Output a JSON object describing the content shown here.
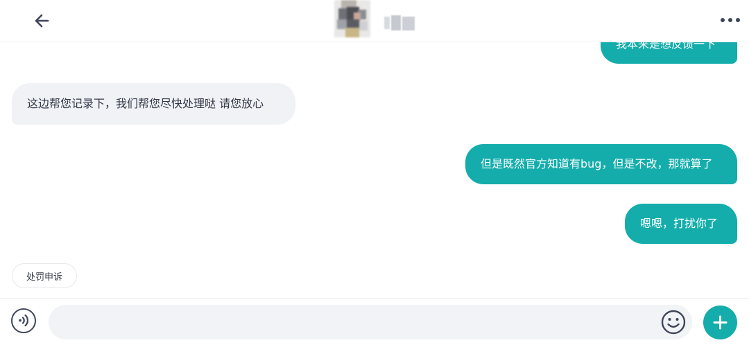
{
  "header": {
    "back_icon": "arrow-left-icon",
    "more_icon": "more-horizontal-icon"
  },
  "messages": [
    {
      "side": "me",
      "text": "我本来是想反馈一下"
    },
    {
      "side": "them",
      "text": "这边帮您记录下，我们帮您尽快处理哒 请您放心"
    },
    {
      "side": "me",
      "text": "但是既然官方知道有bug，但是不改，那就算了"
    },
    {
      "side": "me",
      "text": "嗯嗯，打扰你了"
    }
  ],
  "quick_reply": {
    "label": "处罚申诉"
  },
  "input": {
    "value": "",
    "placeholder": ""
  },
  "colors": {
    "accent": "#14adab",
    "incoming_bubble": "#f0f2f6",
    "icon": "#3f4658"
  }
}
